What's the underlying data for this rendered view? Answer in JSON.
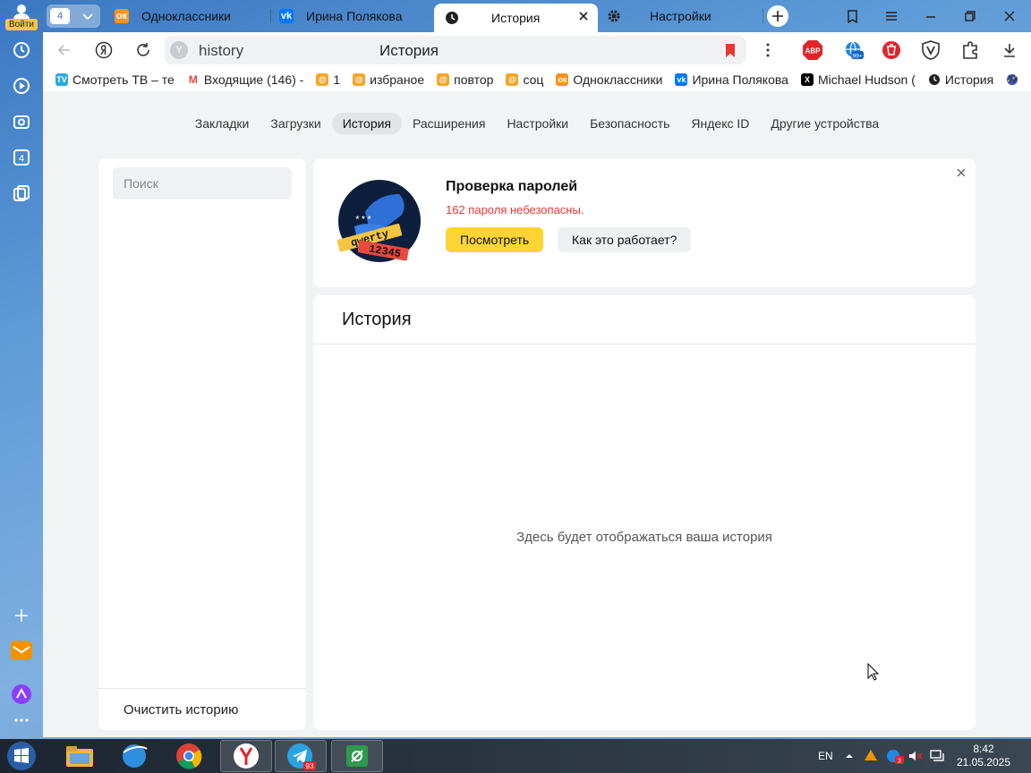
{
  "profile": {
    "login_label": "Войти"
  },
  "tabs": {
    "counter": "4",
    "items": [
      {
        "title": "Одноклассники",
        "icon": "odnoklassniki-icon",
        "color": "#f7931e"
      },
      {
        "title": "Ирина Полякова",
        "icon": "vk-icon",
        "color": "#0077ff"
      },
      {
        "title": "История",
        "icon": "clock-icon",
        "active": true
      },
      {
        "title": "Настройки",
        "icon": "gear-icon"
      }
    ]
  },
  "omnibox": {
    "url": "history",
    "page_title": "История"
  },
  "bookmarks": [
    {
      "label": "Смотреть ТВ – те",
      "icon": "tv-icon",
      "color": "#2aa8e0"
    },
    {
      "label": "Входящие (146) -",
      "icon": "gmail-icon",
      "color": "#ea4335"
    },
    {
      "label": "1",
      "icon": "folder-icon",
      "color": "#f5a623"
    },
    {
      "label": "избраное",
      "icon": "folder-icon",
      "color": "#f5a623"
    },
    {
      "label": "повтор",
      "icon": "folder-icon",
      "color": "#f5a623"
    },
    {
      "label": "соц",
      "icon": "folder-icon",
      "color": "#f5a623"
    },
    {
      "label": "Одноклассники",
      "icon": "odnoklassniki-icon",
      "color": "#f7931e"
    },
    {
      "label": "Ирина Полякова",
      "icon": "vk-icon",
      "color": "#0077ff"
    },
    {
      "label": "Michael Hudson (",
      "icon": "x-icon",
      "color": "#000000"
    },
    {
      "label": "История",
      "icon": "clock-icon",
      "color": "#222222"
    }
  ],
  "settings_nav": [
    {
      "label": "Закладки"
    },
    {
      "label": "Загрузки"
    },
    {
      "label": "История",
      "active": true
    },
    {
      "label": "Расширения"
    },
    {
      "label": "Настройки"
    },
    {
      "label": "Безопасность"
    },
    {
      "label": "Яндекс ID"
    },
    {
      "label": "Другие устройства"
    }
  ],
  "search": {
    "placeholder": "Поиск"
  },
  "left_panel": {
    "clear_label": "Очистить историю"
  },
  "promo": {
    "title": "Проверка паролей",
    "warning": "162 пароля небезопасны.",
    "view_button": "Посмотреть",
    "how_button": "Как это работает?",
    "illustration_text_1": "qwerty",
    "illustration_text_2": "12345",
    "illustration_text_3": "***"
  },
  "history": {
    "heading": "История",
    "empty_text": "Здесь будет отображаться ваша история"
  },
  "taskbar": {
    "language": "EN",
    "time": "8:42",
    "date": "21.05.2025",
    "telegram_badge": "93",
    "tray_badge": "3",
    "ext_badge": "99+",
    "sidebar_badge": "4"
  },
  "colors": {
    "accent_yellow": "#fcd535",
    "warning_red": "#e53935",
    "page_bg": "#f2f3f5"
  }
}
